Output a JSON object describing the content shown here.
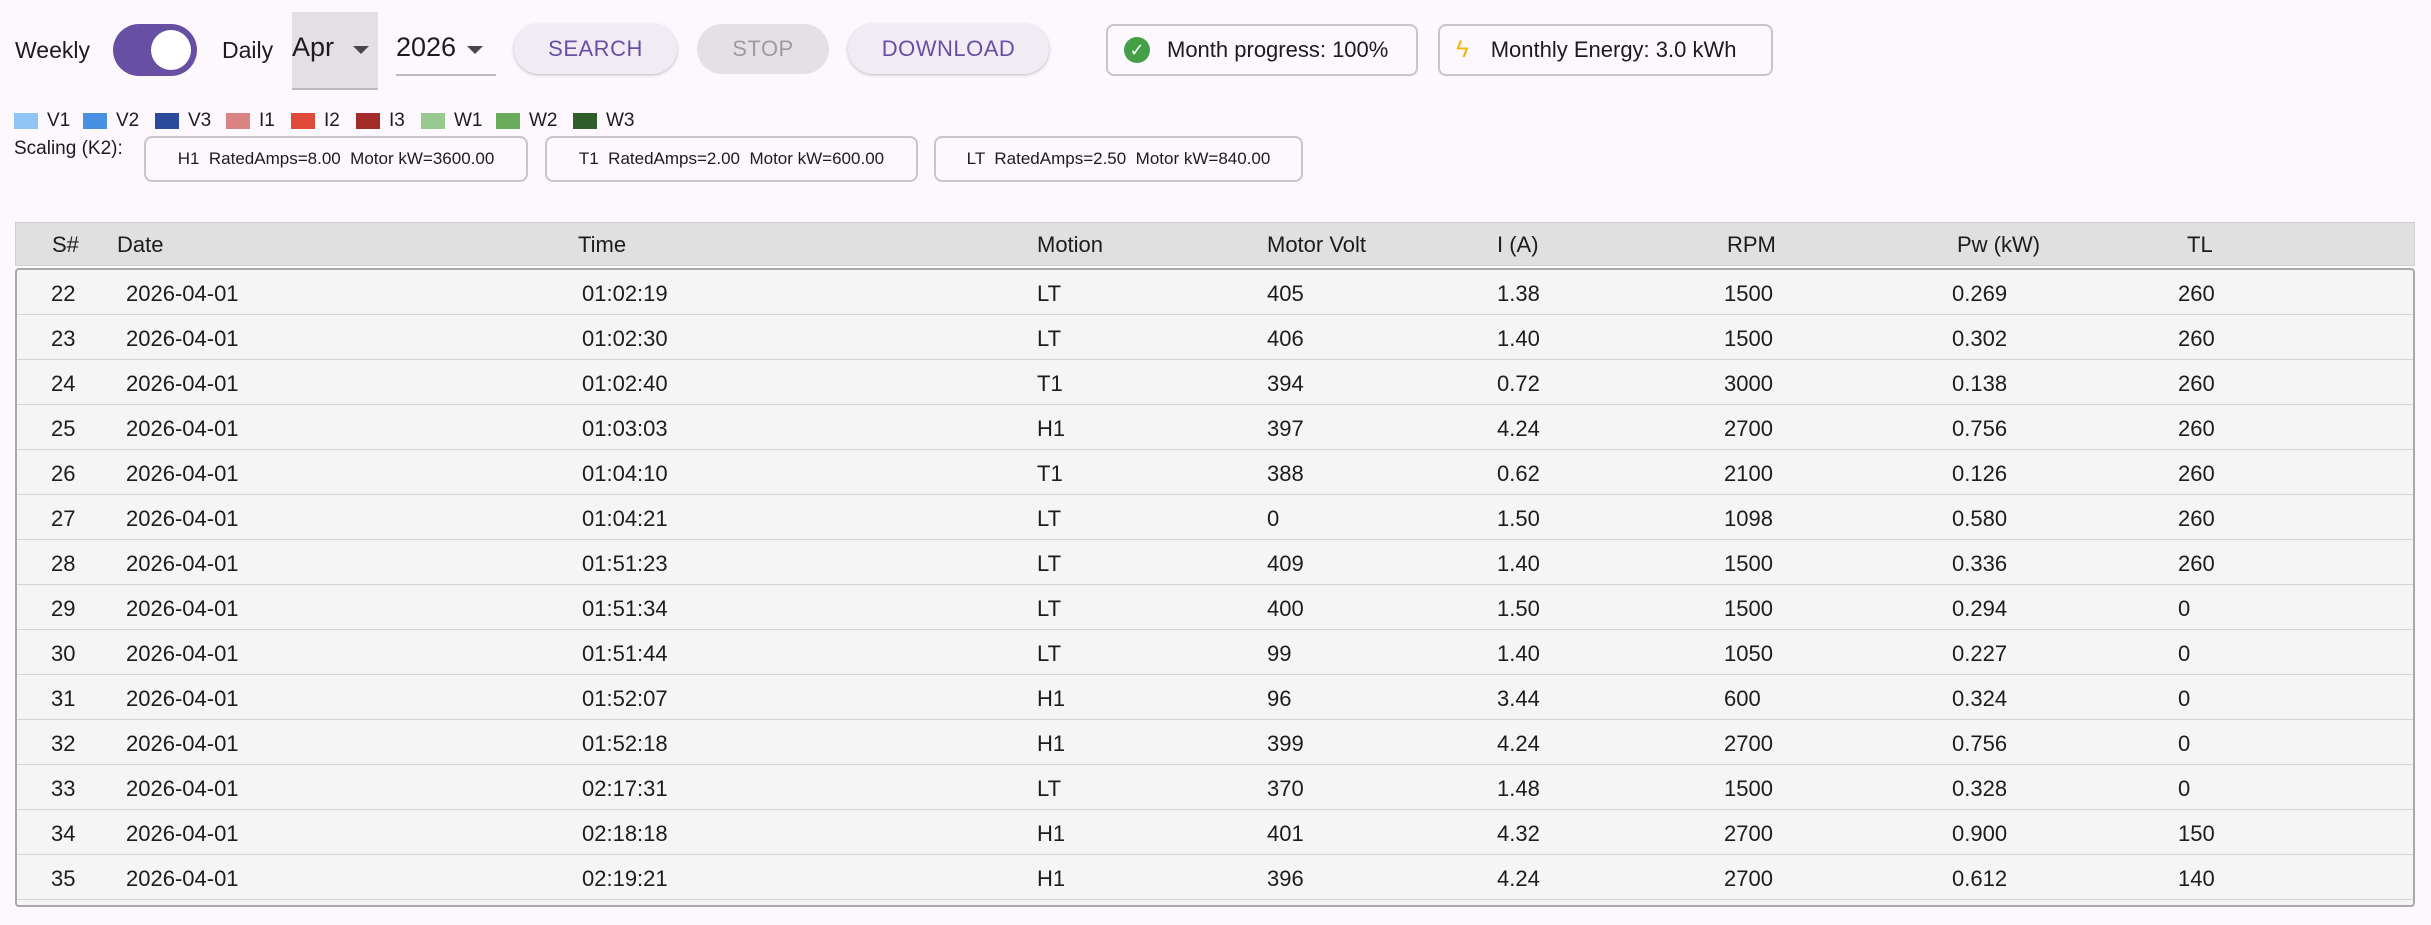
{
  "controls": {
    "weekly_label": "Weekly",
    "daily_label": "Daily",
    "month_value": "Apr",
    "year_value": "2026",
    "search_label": "SEARCH",
    "stop_label": "STOP",
    "download_label": "DOWNLOAD",
    "progress_text": "Month progress: 100%",
    "energy_text": "Monthly Energy: 3.0 kWh"
  },
  "legend": [
    {
      "label": "V1",
      "color": "#90c4f4"
    },
    {
      "label": "V2",
      "color": "#4a90e2"
    },
    {
      "label": "V3",
      "color": "#2b4a9c"
    },
    {
      "label": "I1",
      "color": "#d98383"
    },
    {
      "label": "I2",
      "color": "#e04a3a"
    },
    {
      "label": "I3",
      "color": "#a52a2a"
    },
    {
      "label": "W1",
      "color": "#98c98e"
    },
    {
      "label": "W2",
      "color": "#6aab5c"
    },
    {
      "label": "W3",
      "color": "#2e5e2a"
    }
  ],
  "scaling": {
    "label": "Scaling (K2):",
    "chips": [
      "H1  RatedAmps=8.00  Motor kW=3600.00",
      "T1  RatedAmps=2.00  Motor kW=600.00",
      "LT  RatedAmps=2.50  Motor kW=840.00"
    ]
  },
  "table": {
    "headers": [
      "S#",
      "Date",
      "Time",
      "Motion",
      "Motor Volt",
      "I (A)",
      "RPM",
      "Pw (kW)",
      "TL"
    ],
    "rows": [
      [
        "22",
        "2026-04-01",
        "01:02:19",
        "LT",
        "405",
        "1.38",
        "1500",
        "0.269",
        "260"
      ],
      [
        "23",
        "2026-04-01",
        "01:02:30",
        "LT",
        "406",
        "1.40",
        "1500",
        "0.302",
        "260"
      ],
      [
        "24",
        "2026-04-01",
        "01:02:40",
        "T1",
        "394",
        "0.72",
        "3000",
        "0.138",
        "260"
      ],
      [
        "25",
        "2026-04-01",
        "01:03:03",
        "H1",
        "397",
        "4.24",
        "2700",
        "0.756",
        "260"
      ],
      [
        "26",
        "2026-04-01",
        "01:04:10",
        "T1",
        "388",
        "0.62",
        "2100",
        "0.126",
        "260"
      ],
      [
        "27",
        "2026-04-01",
        "01:04:21",
        "LT",
        "0",
        "1.50",
        "1098",
        "0.580",
        "260"
      ],
      [
        "28",
        "2026-04-01",
        "01:51:23",
        "LT",
        "409",
        "1.40",
        "1500",
        "0.336",
        "260"
      ],
      [
        "29",
        "2026-04-01",
        "01:51:34",
        "LT",
        "400",
        "1.50",
        "1500",
        "0.294",
        "0"
      ],
      [
        "30",
        "2026-04-01",
        "01:51:44",
        "LT",
        "99",
        "1.40",
        "1050",
        "0.227",
        "0"
      ],
      [
        "31",
        "2026-04-01",
        "01:52:07",
        "H1",
        "96",
        "3.44",
        "600",
        "0.324",
        "0"
      ],
      [
        "32",
        "2026-04-01",
        "01:52:18",
        "H1",
        "399",
        "4.24",
        "2700",
        "0.756",
        "0"
      ],
      [
        "33",
        "2026-04-01",
        "02:17:31",
        "LT",
        "370",
        "1.48",
        "1500",
        "0.328",
        "0"
      ],
      [
        "34",
        "2026-04-01",
        "02:18:18",
        "H1",
        "401",
        "4.32",
        "2700",
        "0.900",
        "150"
      ],
      [
        "35",
        "2026-04-01",
        "02:19:21",
        "H1",
        "396",
        "4.24",
        "2700",
        "0.612",
        "140"
      ]
    ]
  }
}
